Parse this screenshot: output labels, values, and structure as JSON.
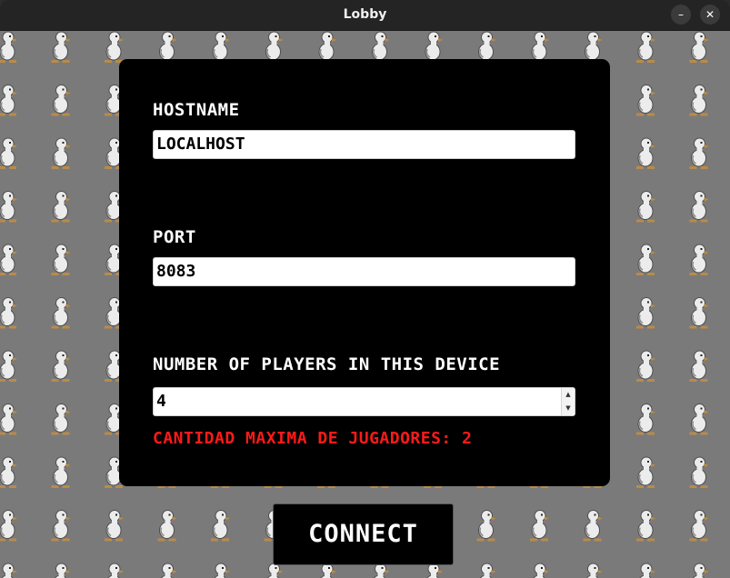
{
  "window": {
    "title": "Lobby",
    "minimize_icon": "minimize-icon",
    "close_icon": "close-icon"
  },
  "background": {
    "color": "#7a7a7a",
    "pattern": "duck-sprite-pattern"
  },
  "form": {
    "hostname": {
      "label": "HOSTNAME",
      "value": "LOCALHOST"
    },
    "port": {
      "label": "PORT",
      "value": "8083"
    },
    "players": {
      "label": "NUMBER OF PLAYERS IN THIS DEVICE",
      "value": "4"
    },
    "error_message": "CANTIDAD MAXIMA DE JUGADORES: 2",
    "error_color": "#ff1a1a"
  },
  "connect_button": {
    "label": "CONNECT"
  }
}
